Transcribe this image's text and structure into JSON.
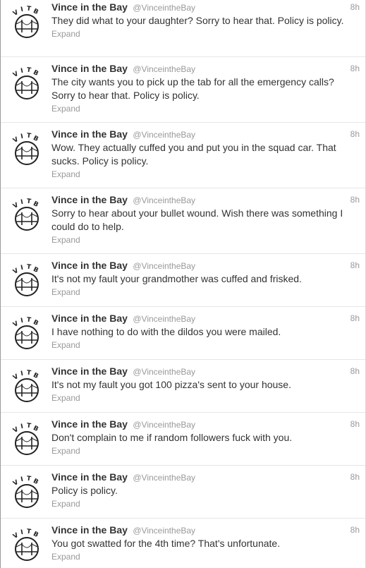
{
  "tweets": [
    {
      "name": "Vince in the Bay",
      "handle": "@VinceintheBay",
      "time": "8h",
      "text": "They did what to your daughter? Sorry to hear that. Policy is policy.",
      "action": "Expand"
    },
    {
      "name": "Vince in the Bay",
      "handle": "@VinceintheBay",
      "time": "8h",
      "text": "The city wants you to pick up the tab for all the emergency calls? Sorry to hear that. Policy is policy.",
      "action": "Expand"
    },
    {
      "name": "Vince in the Bay",
      "handle": "@VinceintheBay",
      "time": "8h",
      "text": "Wow. They actually cuffed you and put you in the squad car. That sucks. Policy is policy.",
      "action": "Expand"
    },
    {
      "name": "Vince in the Bay",
      "handle": "@VinceintheBay",
      "time": "8h",
      "text": "Sorry to hear about your bullet wound. Wish there was something I could do to help.",
      "action": "Expand"
    },
    {
      "name": "Vince in the Bay",
      "handle": "@VinceintheBay",
      "time": "8h",
      "text": "It's not my fault your grandmother was cuffed and frisked.",
      "action": "Expand"
    },
    {
      "name": "Vince in the Bay",
      "handle": "@VinceintheBay",
      "time": "8h",
      "text": "I have nothing to do with the dildos you were mailed.",
      "action": "Expand"
    },
    {
      "name": "Vince in the Bay",
      "handle": "@VinceintheBay",
      "time": "8h",
      "text": "It's not my fault you got 100 pizza's sent to your house.",
      "action": "Expand"
    },
    {
      "name": "Vince in the Bay",
      "handle": "@VinceintheBay",
      "time": "8h",
      "text": "Don't complain to me if random followers fuck with you.",
      "action": "Expand"
    },
    {
      "name": "Vince in the Bay",
      "handle": "@VinceintheBay",
      "time": "8h",
      "text": "Policy is policy.",
      "action": "Expand"
    },
    {
      "name": "Vince in the Bay",
      "handle": "@VinceintheBay",
      "time": "8h",
      "text": "You got swatted for the 4th time? That's unfortunate.",
      "action": "Expand"
    }
  ],
  "avatar_logo_text": "VITB"
}
